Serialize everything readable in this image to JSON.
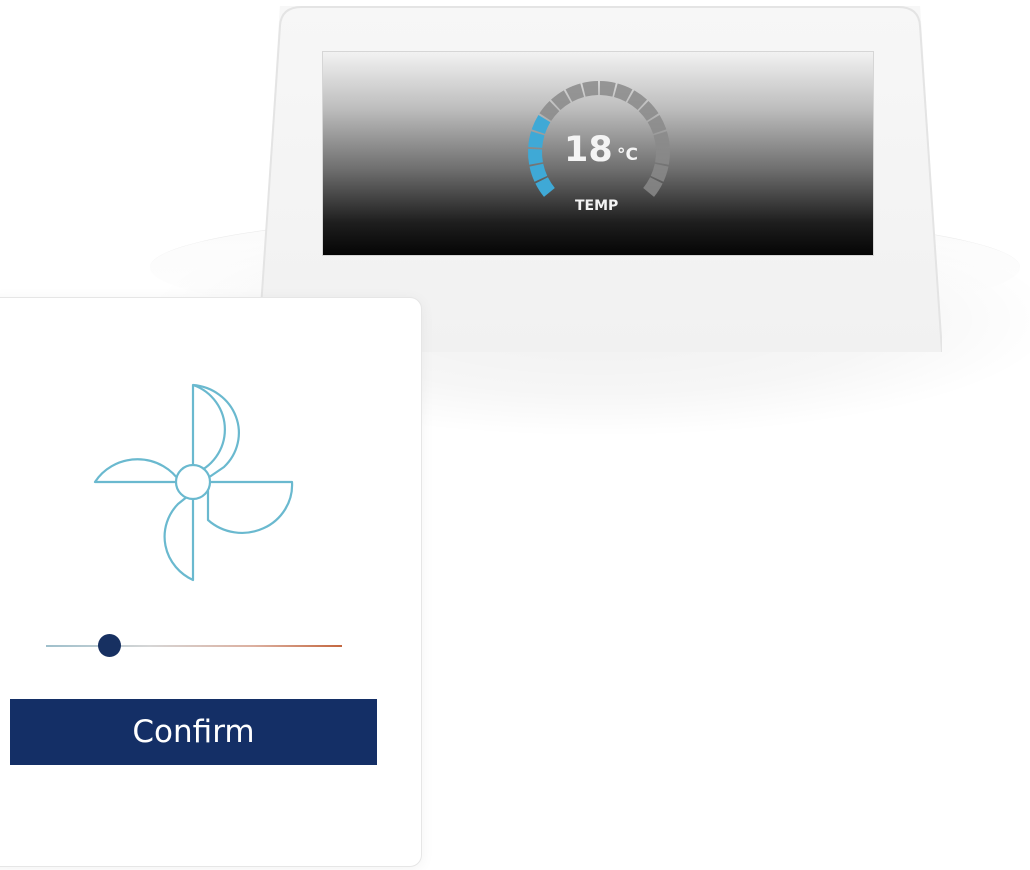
{
  "thermostat": {
    "temperature": "18",
    "unit": "°C",
    "label": "TEMP",
    "gauge_fill_fraction": 0.3,
    "gauge_active_color": "#3fa9d6",
    "gauge_inactive_color": "#8a8a8a"
  },
  "fan_control": {
    "icon": "fan-icon",
    "icon_color": "#6ab9cf",
    "speed_fraction": 0.2,
    "slider_thumb_color": "#173061",
    "confirm_label": "Confirm",
    "confirm_color": "#142f66"
  }
}
